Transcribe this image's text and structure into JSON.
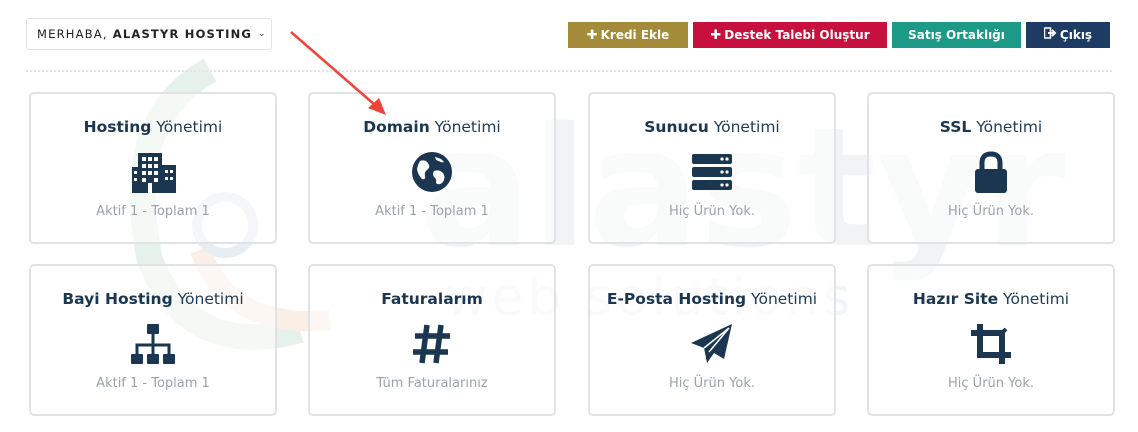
{
  "header": {
    "greeting": "MERHABA,",
    "user_name": "ALASTYR HOSTING",
    "chevron": "chevron-down-icon"
  },
  "buttons": {
    "kredi": {
      "label": "Kredi Ekle",
      "icon": "plus-icon",
      "color": "#a48b3a"
    },
    "destek": {
      "label": "Destek Talebi Oluştur",
      "icon": "plus-icon",
      "color": "#c8103f"
    },
    "satis": {
      "label": "Satış Ortaklığı",
      "color": "#1c9a87"
    },
    "cikis": {
      "label": "Çıkış",
      "icon": "logout-icon",
      "color": "#1d3b63"
    }
  },
  "cards": [
    {
      "title_bold": "Hosting",
      "title_rest": " Yönetimi",
      "icon": "building-icon",
      "status": "Aktif 1 - Toplam 1"
    },
    {
      "title_bold": "Domain",
      "title_rest": " Yönetimi",
      "icon": "globe-icon",
      "status": "Aktif 1 - Toplam 1"
    },
    {
      "title_bold": "Sunucu",
      "title_rest": " Yönetimi",
      "icon": "server-icon",
      "status": "Hiç Ürün Yok."
    },
    {
      "title_bold": "SSL",
      "title_rest": " Yönetimi",
      "icon": "lock-icon",
      "status": "Hiç Ürün Yok."
    },
    {
      "title_bold": "Bayi Hosting",
      "title_rest": " Yönetimi",
      "icon": "sitemap-icon",
      "status": "Aktif 1 - Toplam 1"
    },
    {
      "title_bold": "Faturalarım",
      "title_rest": "",
      "icon": "hashtag-icon",
      "status": "Tüm Faturalarınız"
    },
    {
      "title_bold": "E-Posta Hosting",
      "title_rest": " Yönetimi",
      "icon": "paper-plane-icon",
      "status": "Hiç Ürün Yok."
    },
    {
      "title_bold": "Hazır Site",
      "title_rest": " Yönetimi",
      "icon": "crop-icon",
      "status": "Hiç Ürün Yok."
    }
  ],
  "watermark": {
    "brand": "alastyr",
    "tagline": "web solutions"
  },
  "colors": {
    "icon": "#1a3651",
    "arrow": "#f0433a"
  }
}
